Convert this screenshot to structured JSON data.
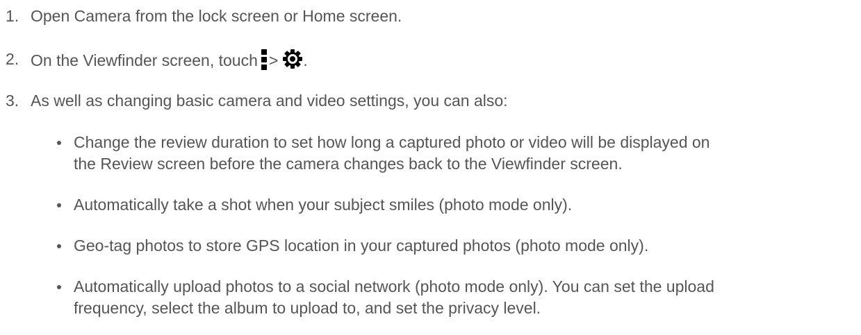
{
  "steps": [
    {
      "number": "1.",
      "text": "Open Camera from the lock screen or Home screen."
    },
    {
      "number": "2.",
      "text_before": "On the Viewfinder screen, touch",
      "separator": ">",
      "text_after": ".",
      "icons": [
        "menu-icon",
        "settings-gear-icon"
      ]
    },
    {
      "number": "3.",
      "text": "As well as changing basic camera and video settings, you can also:"
    }
  ],
  "bullets": [
    {
      "lines": [
        "Change the review duration to set how long a captured photo or video will be displayed on",
        "the Review screen before the camera changes back to the Viewfinder screen."
      ]
    },
    {
      "lines": [
        "Automatically take a shot when your subject smiles (photo mode only)."
      ]
    },
    {
      "lines": [
        "Geo-tag photos to store GPS location in your captured photos (photo mode only)."
      ]
    },
    {
      "lines": [
        "Automatically upload photos to a social network (photo mode only). You can set the upload",
        "frequency, select the album to upload to, and set the privacy level."
      ]
    }
  ],
  "colors": {
    "text": "#555555",
    "icon": "#000000"
  }
}
